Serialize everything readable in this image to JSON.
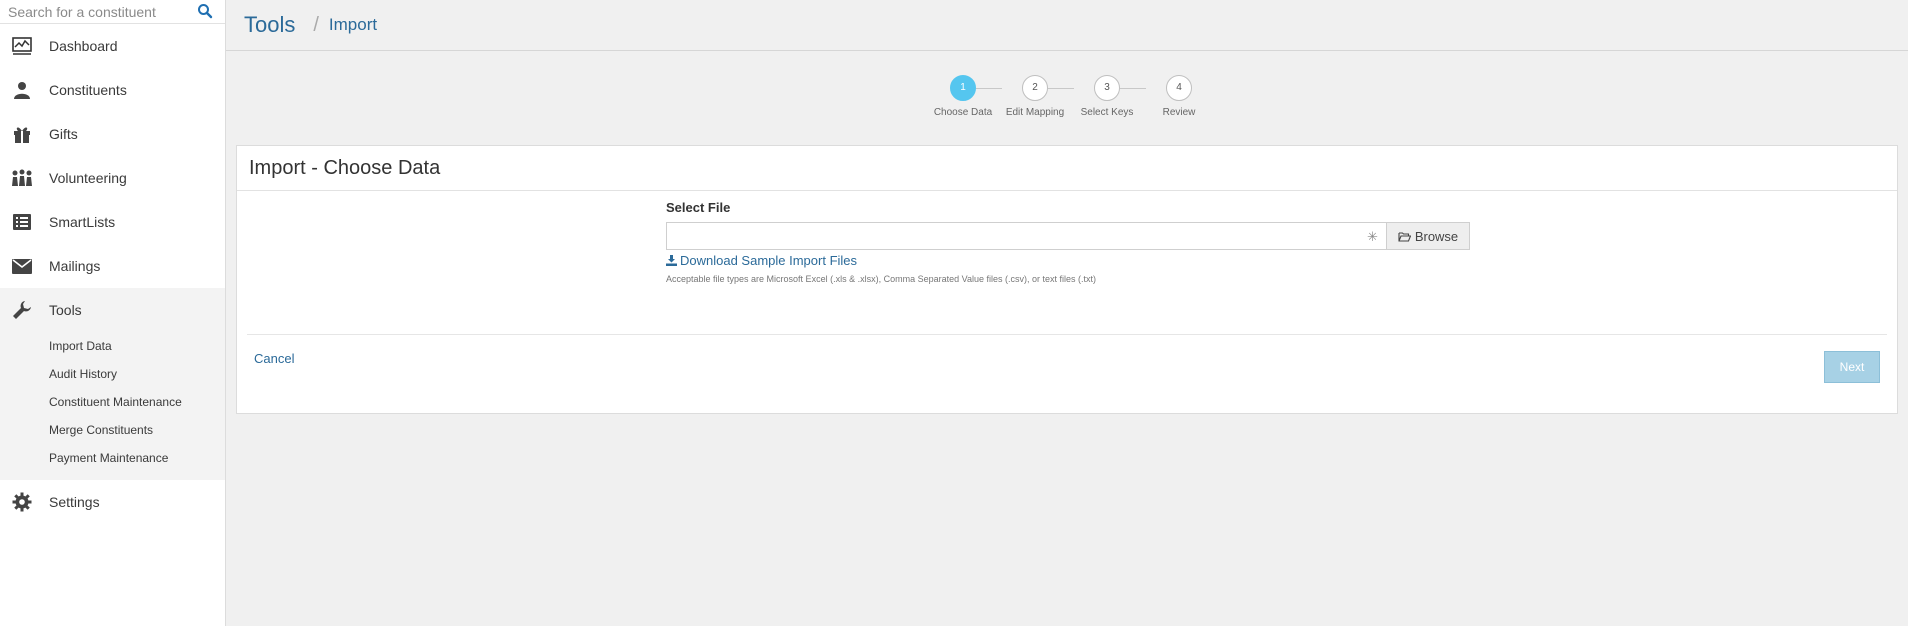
{
  "search": {
    "placeholder": "Search for a constituent"
  },
  "sidebar": {
    "items": [
      {
        "label": "Dashboard"
      },
      {
        "label": "Constituents"
      },
      {
        "label": "Gifts"
      },
      {
        "label": "Volunteering"
      },
      {
        "label": "SmartLists"
      },
      {
        "label": "Mailings"
      },
      {
        "label": "Tools"
      },
      {
        "label": "Settings"
      }
    ],
    "tools_sub": [
      {
        "label": "Import Data"
      },
      {
        "label": "Audit History"
      },
      {
        "label": "Constituent Maintenance"
      },
      {
        "label": "Merge Constituents"
      },
      {
        "label": "Payment Maintenance"
      }
    ]
  },
  "header": {
    "crumb_main": "Tools",
    "separator": "/",
    "crumb_sub": "Import"
  },
  "stepper": {
    "steps": [
      {
        "number": "1",
        "label": "Choose Data",
        "active": true
      },
      {
        "number": "2",
        "label": "Edit Mapping",
        "active": false
      },
      {
        "number": "3",
        "label": "Select Keys",
        "active": false
      },
      {
        "number": "4",
        "label": "Review",
        "active": false
      }
    ]
  },
  "panel": {
    "title": "Import - Choose Data",
    "field_label": "Select File",
    "browse_label": "Browse",
    "download_link": "Download Sample Import Files",
    "help_text": "Acceptable file types are Microsoft Excel (.xls & .xlsx), Comma Separated Value files (.csv), or text files (.txt)",
    "cancel_label": "Cancel",
    "next_label": "Next"
  },
  "colors": {
    "accent": "#2b6a99",
    "step_active": "#55c6ef",
    "next_disabled": "#a7d1e5"
  }
}
